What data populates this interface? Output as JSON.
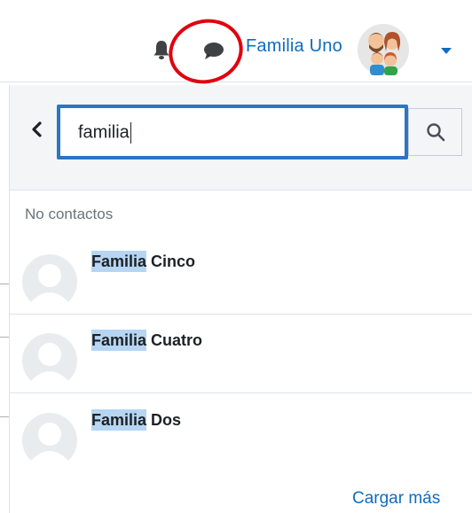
{
  "navbar": {
    "user_name": "Familia Uno",
    "icons": [
      "bell-icon",
      "chat-icon",
      "caret-down-icon"
    ]
  },
  "drawer": {
    "search": {
      "value": "familia",
      "button_icon": "search-icon"
    },
    "contacts_notice": "No contactos",
    "results": [
      {
        "highlight": "Familia",
        "rest": " Cinco"
      },
      {
        "highlight": "Familia",
        "rest": " Cuatro"
      },
      {
        "highlight": "Familia",
        "rest": " Dos"
      }
    ],
    "load_more": "Cargar más"
  },
  "colors": {
    "link": "#0f6cbf",
    "focus": "#2a76c4",
    "annotation": "#e0000f",
    "highlight": "#b6d5f2"
  }
}
